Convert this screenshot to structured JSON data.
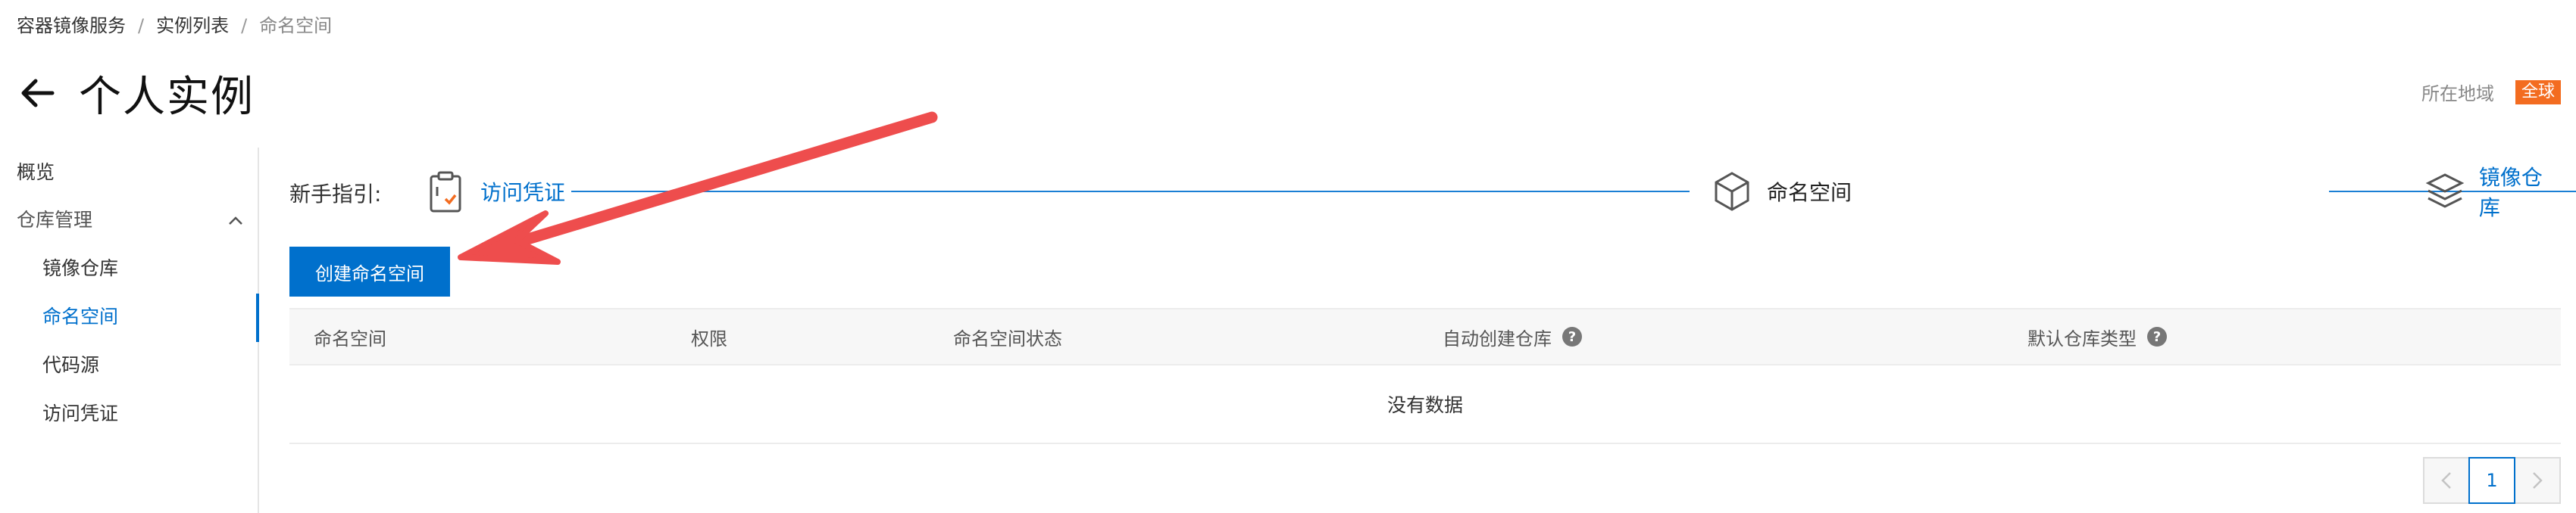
{
  "breadcrumb": {
    "items": [
      "容器镜像服务",
      "实例列表",
      "命名空间"
    ],
    "separator": "/"
  },
  "header": {
    "back_icon": "arrow-left-icon",
    "title": "个人实例",
    "region_label": "所在地域",
    "region_value": "全球",
    "region_badge_color": "#f36c20"
  },
  "sidebar": {
    "overview": "概览",
    "group_label": "仓库管理",
    "group_icon": "chevron-up-icon",
    "items": [
      {
        "label": "镜像仓库",
        "active": false
      },
      {
        "label": "命名空间",
        "active": true
      },
      {
        "label": "代码源",
        "active": false
      },
      {
        "label": "访问凭证",
        "active": false
      }
    ]
  },
  "guide": {
    "label": "新手指引:",
    "steps": [
      {
        "label": "访问凭证",
        "icon": "credential-icon",
        "link": true
      },
      {
        "label": "命名空间",
        "icon": "cube-icon",
        "link": false
      },
      {
        "label": "镜像仓库",
        "icon": "layers-icon",
        "link": true
      }
    ]
  },
  "actions": {
    "create_label": "创建命名空间"
  },
  "table": {
    "columns": [
      "命名空间",
      "权限",
      "命名空间状态",
      "自动创建仓库",
      "默认仓库类型"
    ],
    "help_icon": "?",
    "empty_text": "没有数据"
  },
  "pagination": {
    "current_page": "1",
    "prev_icon": "chevron-left-icon",
    "next_icon": "chevron-right-icon"
  },
  "colors": {
    "accent": "#0070cc",
    "annotation_arrow": "#ee4d4d"
  }
}
